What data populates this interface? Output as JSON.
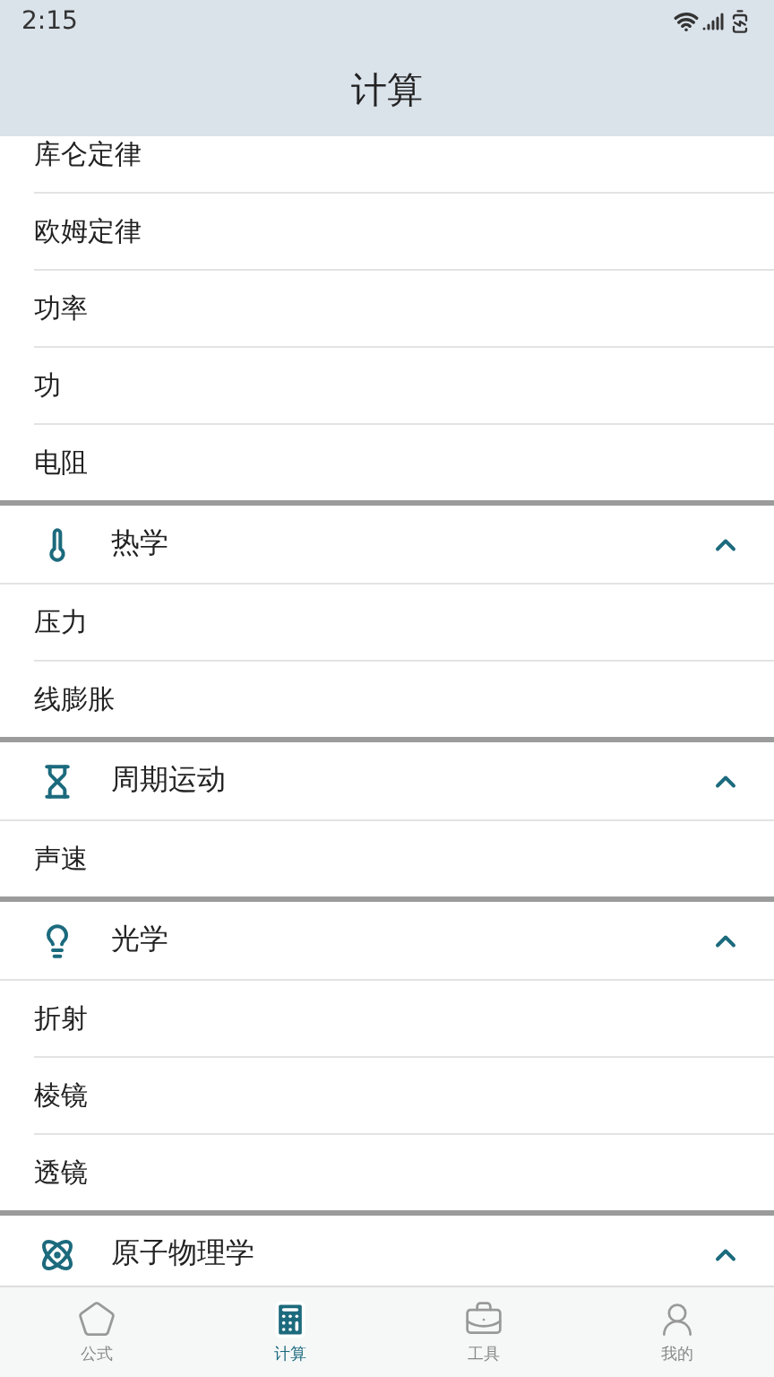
{
  "status_bar": {
    "time": "2:15"
  },
  "header": {
    "title": "计算"
  },
  "partial_section": {
    "items": [
      "库仑定律",
      "欧姆定律",
      "功率",
      "功",
      "电阻"
    ]
  },
  "sections": [
    {
      "title": "热学",
      "kind": "thermometer",
      "expanded": true,
      "items": [
        "压力",
        "线膨胀"
      ]
    },
    {
      "title": "周期运动",
      "kind": "hourglass",
      "expanded": true,
      "items": [
        "声速"
      ]
    },
    {
      "title": "光学",
      "kind": "bulb",
      "expanded": true,
      "items": [
        "折射",
        "棱镜",
        "透镜"
      ]
    },
    {
      "title": "原子物理学",
      "kind": "atom",
      "expanded": true
    }
  ],
  "bottom_nav": [
    {
      "label": "公式",
      "kind": "pentagon",
      "selected": false
    },
    {
      "label": "计算",
      "kind": "calculator",
      "selected": true
    },
    {
      "label": "工具",
      "kind": "toolbox",
      "selected": false
    },
    {
      "label": "我的",
      "kind": "person",
      "selected": false
    }
  ]
}
